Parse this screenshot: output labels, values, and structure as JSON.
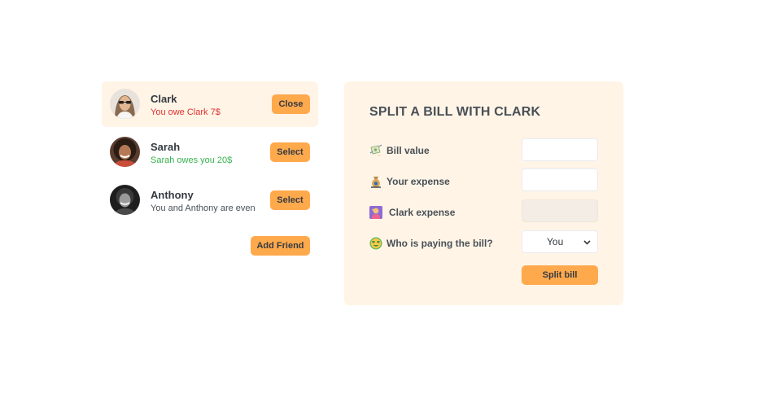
{
  "friends": [
    {
      "name": "Clark",
      "status": "You owe Clark 7$",
      "button": "Close",
      "selected": true
    },
    {
      "name": "Sarah",
      "status": "Sarah owes you 20$",
      "button": "Select",
      "selected": false
    },
    {
      "name": "Anthony",
      "status": "You and Anthony are even",
      "button": "Select",
      "selected": false
    }
  ],
  "add_friend_label": "Add Friend",
  "form": {
    "title": "SPLIT A BILL WITH CLARK",
    "bill_label": "Bill value",
    "bill_value": "",
    "your_expense_label": "Your expense",
    "your_expense_value": "",
    "friend_expense_label": "Clark expense",
    "friend_expense_value": "",
    "payer_label": "Who is paying the bill?",
    "payer_selected": "You",
    "submit_label": "Split bill"
  },
  "colors": {
    "accent": "#ffa94d",
    "panel": "#fff4e6",
    "owe": "#e03131",
    "owed": "#37b24d"
  },
  "icons": {
    "bill": "money-with-wings-icon",
    "expense": "money-bag-icon",
    "friend_expense": "person-raising-hand-icon",
    "payer": "money-mouth-face-icon"
  }
}
